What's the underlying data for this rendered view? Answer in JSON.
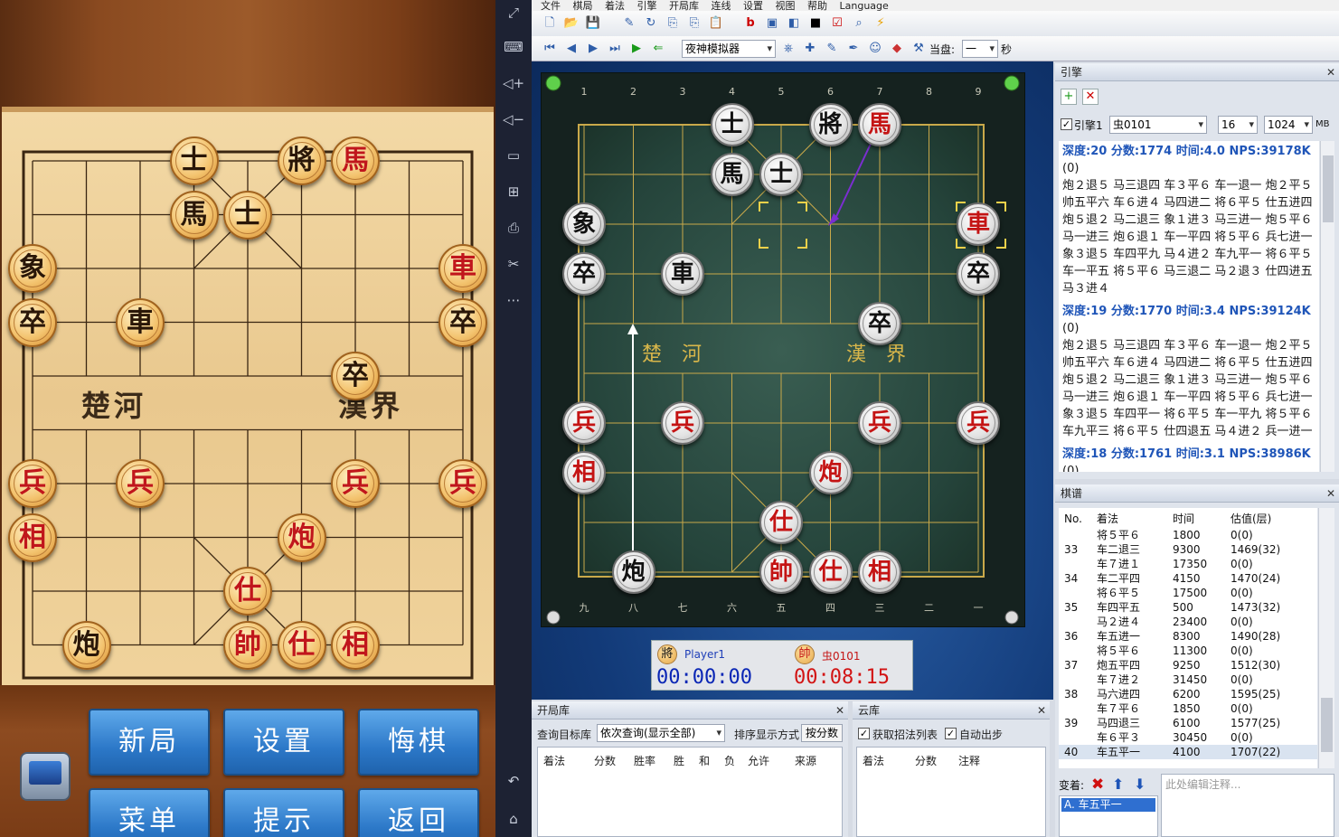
{
  "phone": {
    "buttons": [
      {
        "id": "new",
        "label": "新局"
      },
      {
        "id": "settings",
        "label": "设置"
      },
      {
        "id": "undo",
        "label": "悔棋"
      },
      {
        "id": "menu",
        "label": "菜单"
      },
      {
        "id": "hint",
        "label": "提示"
      },
      {
        "id": "back",
        "label": "返回"
      }
    ],
    "river_left": "楚河",
    "river_right": "漢界"
  },
  "menu": {
    "items": [
      "文件",
      "棋局",
      "着法",
      "引擎",
      "开局库",
      "连线",
      "设置",
      "视图",
      "帮助",
      "Language"
    ]
  },
  "toolbar": {
    "engine_select": "夜神模拟器",
    "time_label": "当盘:",
    "time_value": "一",
    "time_unit": "秒"
  },
  "board": {
    "top_coords": [
      "1",
      "2",
      "3",
      "4",
      "5",
      "6",
      "7",
      "8",
      "9"
    ],
    "bottom_coords": [
      "九",
      "八",
      "七",
      "六",
      "五",
      "四",
      "三",
      "二",
      "一"
    ],
    "river_left": "楚　河",
    "river_right": "漢　界",
    "pieces": [
      {
        "side": "black",
        "char": "士",
        "file": 4,
        "rank": 0
      },
      {
        "side": "black",
        "char": "將",
        "file": 6,
        "rank": 0
      },
      {
        "side": "red",
        "char": "馬",
        "file": 7,
        "rank": 0
      },
      {
        "side": "black",
        "char": "馬",
        "file": 4,
        "rank": 1
      },
      {
        "side": "black",
        "char": "士",
        "file": 5,
        "rank": 1
      },
      {
        "side": "black",
        "char": "象",
        "file": 1,
        "rank": 2
      },
      {
        "side": "red",
        "char": "車",
        "file": 9,
        "rank": 2
      },
      {
        "side": "black",
        "char": "卒",
        "file": 1,
        "rank": 3
      },
      {
        "side": "black",
        "char": "車",
        "file": 3,
        "rank": 3
      },
      {
        "side": "black",
        "char": "卒",
        "file": 9,
        "rank": 3
      },
      {
        "side": "black",
        "char": "卒",
        "file": 7,
        "rank": 4
      },
      {
        "side": "red",
        "char": "兵",
        "file": 1,
        "rank": 6
      },
      {
        "side": "red",
        "char": "兵",
        "file": 3,
        "rank": 6
      },
      {
        "side": "red",
        "char": "兵",
        "file": 7,
        "rank": 6
      },
      {
        "side": "red",
        "char": "兵",
        "file": 9,
        "rank": 6
      },
      {
        "side": "red",
        "char": "相",
        "file": 1,
        "rank": 7
      },
      {
        "side": "red",
        "char": "炮",
        "file": 6,
        "rank": 7
      },
      {
        "side": "red",
        "char": "仕",
        "file": 5,
        "rank": 8
      },
      {
        "side": "black",
        "char": "炮",
        "file": 2,
        "rank": 9
      },
      {
        "side": "red",
        "char": "帥",
        "file": 5,
        "rank": 9
      },
      {
        "side": "red",
        "char": "仕",
        "file": 6,
        "rank": 9
      },
      {
        "side": "red",
        "char": "相",
        "file": 7,
        "rank": 9
      }
    ],
    "phone_pieces": [
      {
        "side": "black",
        "char": "士",
        "file": 4,
        "rank": 0
      },
      {
        "side": "black",
        "char": "將",
        "file": 6,
        "rank": 0
      },
      {
        "side": "red",
        "char": "馬",
        "file": 7,
        "rank": 0
      },
      {
        "side": "black",
        "char": "馬",
        "file": 4,
        "rank": 1
      },
      {
        "side": "black",
        "char": "士",
        "file": 5,
        "rank": 1
      },
      {
        "side": "black",
        "char": "象",
        "file": 1,
        "rank": 2
      },
      {
        "side": "red",
        "char": "車",
        "file": 9,
        "rank": 2
      },
      {
        "side": "black",
        "char": "卒",
        "file": 1,
        "rank": 3
      },
      {
        "side": "black",
        "char": "車",
        "file": 3,
        "rank": 3
      },
      {
        "side": "black",
        "char": "卒",
        "file": 9,
        "rank": 3
      },
      {
        "side": "black",
        "char": "卒",
        "file": 7,
        "rank": 4
      },
      {
        "side": "red",
        "char": "兵",
        "file": 1,
        "rank": 6
      },
      {
        "side": "red",
        "char": "兵",
        "file": 3,
        "rank": 6
      },
      {
        "side": "red",
        "char": "兵",
        "file": 7,
        "rank": 6
      },
      {
        "side": "red",
        "char": "兵",
        "file": 9,
        "rank": 6
      },
      {
        "side": "red",
        "char": "相",
        "file": 1,
        "rank": 7
      },
      {
        "side": "red",
        "char": "炮",
        "file": 6,
        "rank": 7
      },
      {
        "side": "red",
        "char": "仕",
        "file": 5,
        "rank": 8
      },
      {
        "side": "black",
        "char": "炮",
        "file": 2,
        "rank": 9
      },
      {
        "side": "red",
        "char": "帥",
        "file": 5,
        "rank": 9
      },
      {
        "side": "red",
        "char": "仕",
        "file": 6,
        "rank": 9
      },
      {
        "side": "red",
        "char": "相",
        "file": 7,
        "rank": 9
      }
    ]
  },
  "clock": {
    "black_icon": "將",
    "black_name": "Player1",
    "black_time": "00:00:00",
    "red_icon": "帥",
    "red_name": "虫0101",
    "red_time": "00:08:15"
  },
  "engine": {
    "title": "引擎",
    "engine_label": "引擎1",
    "engine_name": "虫0101",
    "threads": "16",
    "hash": "1024",
    "hash_unit": "MB",
    "lines": [
      {
        "head": "深度:20  分数:1774  时间:4.0  NPS:39178K",
        "pv": "(0)\n炮２退５ 马三退四 车３平６ 车一退一 炮２平５ 帅五平六 车６进４ 马四进二 将６平５ 仕五进四 炮５退２ 马二退三 象１进３ 马三进一 炮５平６ 马一进三 炮６退１ 车一平四 将５平６ 兵七进一 象３退５ 车四平九 马４进２ 车九平一 将６平５ 车一平五 将５平６ 马三退二 马２退３ 仕四进五 马３进４"
      },
      {
        "head": "深度:19  分数:1770  时间:3.4  NPS:39124K",
        "pv": "(0)\n炮２退５ 马三退四 车３平６ 车一退一 炮２平５ 帅五平六 车６进４ 马四进二 将６平５ 仕五进四 炮５退２ 马二退三 象１进３ 马三进一 炮５平６ 马一进三 炮６退１ 车一平四 将５平６ 兵七进一 象３退５ 车四平一 将６平５ 车一平九 将５平６ 车九平三 将６平５ 仕四退五 马４进２ 兵一进一"
      },
      {
        "head": "深度:18  分数:1761  时间:3.1  NPS:38986K",
        "pv": "(0)"
      }
    ]
  },
  "moves": {
    "title": "棋谱",
    "headers": [
      "No.",
      "着法",
      "时间",
      "估值(层)"
    ],
    "rows": [
      {
        "no": "",
        "move": "将５平６",
        "time": "1800",
        "eval": "0(0)"
      },
      {
        "no": "33",
        "move": "车二退三",
        "time": "9300",
        "eval": "1469(32)"
      },
      {
        "no": "",
        "move": "车７进１",
        "time": "17350",
        "eval": "0(0)"
      },
      {
        "no": "34",
        "move": "车二平四",
        "time": "4150",
        "eval": "1470(24)"
      },
      {
        "no": "",
        "move": "将６平５",
        "time": "17500",
        "eval": "0(0)"
      },
      {
        "no": "35",
        "move": "车四平五",
        "time": "500",
        "eval": "1473(32)"
      },
      {
        "no": "",
        "move": "马２进４",
        "time": "23400",
        "eval": "0(0)"
      },
      {
        "no": "36",
        "move": "车五进一",
        "time": "8300",
        "eval": "1490(28)"
      },
      {
        "no": "",
        "move": "将５平６",
        "time": "11300",
        "eval": "0(0)"
      },
      {
        "no": "37",
        "move": "炮五平四",
        "time": "9250",
        "eval": "1512(30)"
      },
      {
        "no": "",
        "move": "车７进２",
        "time": "31450",
        "eval": "0(0)"
      },
      {
        "no": "38",
        "move": "马六进四",
        "time": "6200",
        "eval": "1595(25)"
      },
      {
        "no": "",
        "move": "车７平６",
        "time": "1850",
        "eval": "0(0)"
      },
      {
        "no": "39",
        "move": "马四退三",
        "time": "6100",
        "eval": "1577(25)"
      },
      {
        "no": "",
        "move": "车６平３",
        "time": "30450",
        "eval": "0(0)"
      },
      {
        "no": "40",
        "move": "车五平一",
        "time": "4100",
        "eval": "1707(22)"
      }
    ],
    "variation_label": "变着:",
    "variation_item": "A. 车五平一",
    "comment_placeholder": "此处编辑注释..."
  },
  "opening": {
    "title": "开局库",
    "query_label": "查询目标库",
    "query_value": "依次查询(显示全部)",
    "sort_label": "排序显示方式",
    "sort_value": "按分数",
    "headers": [
      "着法",
      "分数",
      "胜率",
      "胜",
      "和",
      "负",
      "允许",
      "来源"
    ]
  },
  "cloud": {
    "title": "云库",
    "fetch_label": "获取招法列表",
    "auto_label": "自动出步",
    "headers": [
      "着法",
      "分数",
      "注释"
    ]
  }
}
